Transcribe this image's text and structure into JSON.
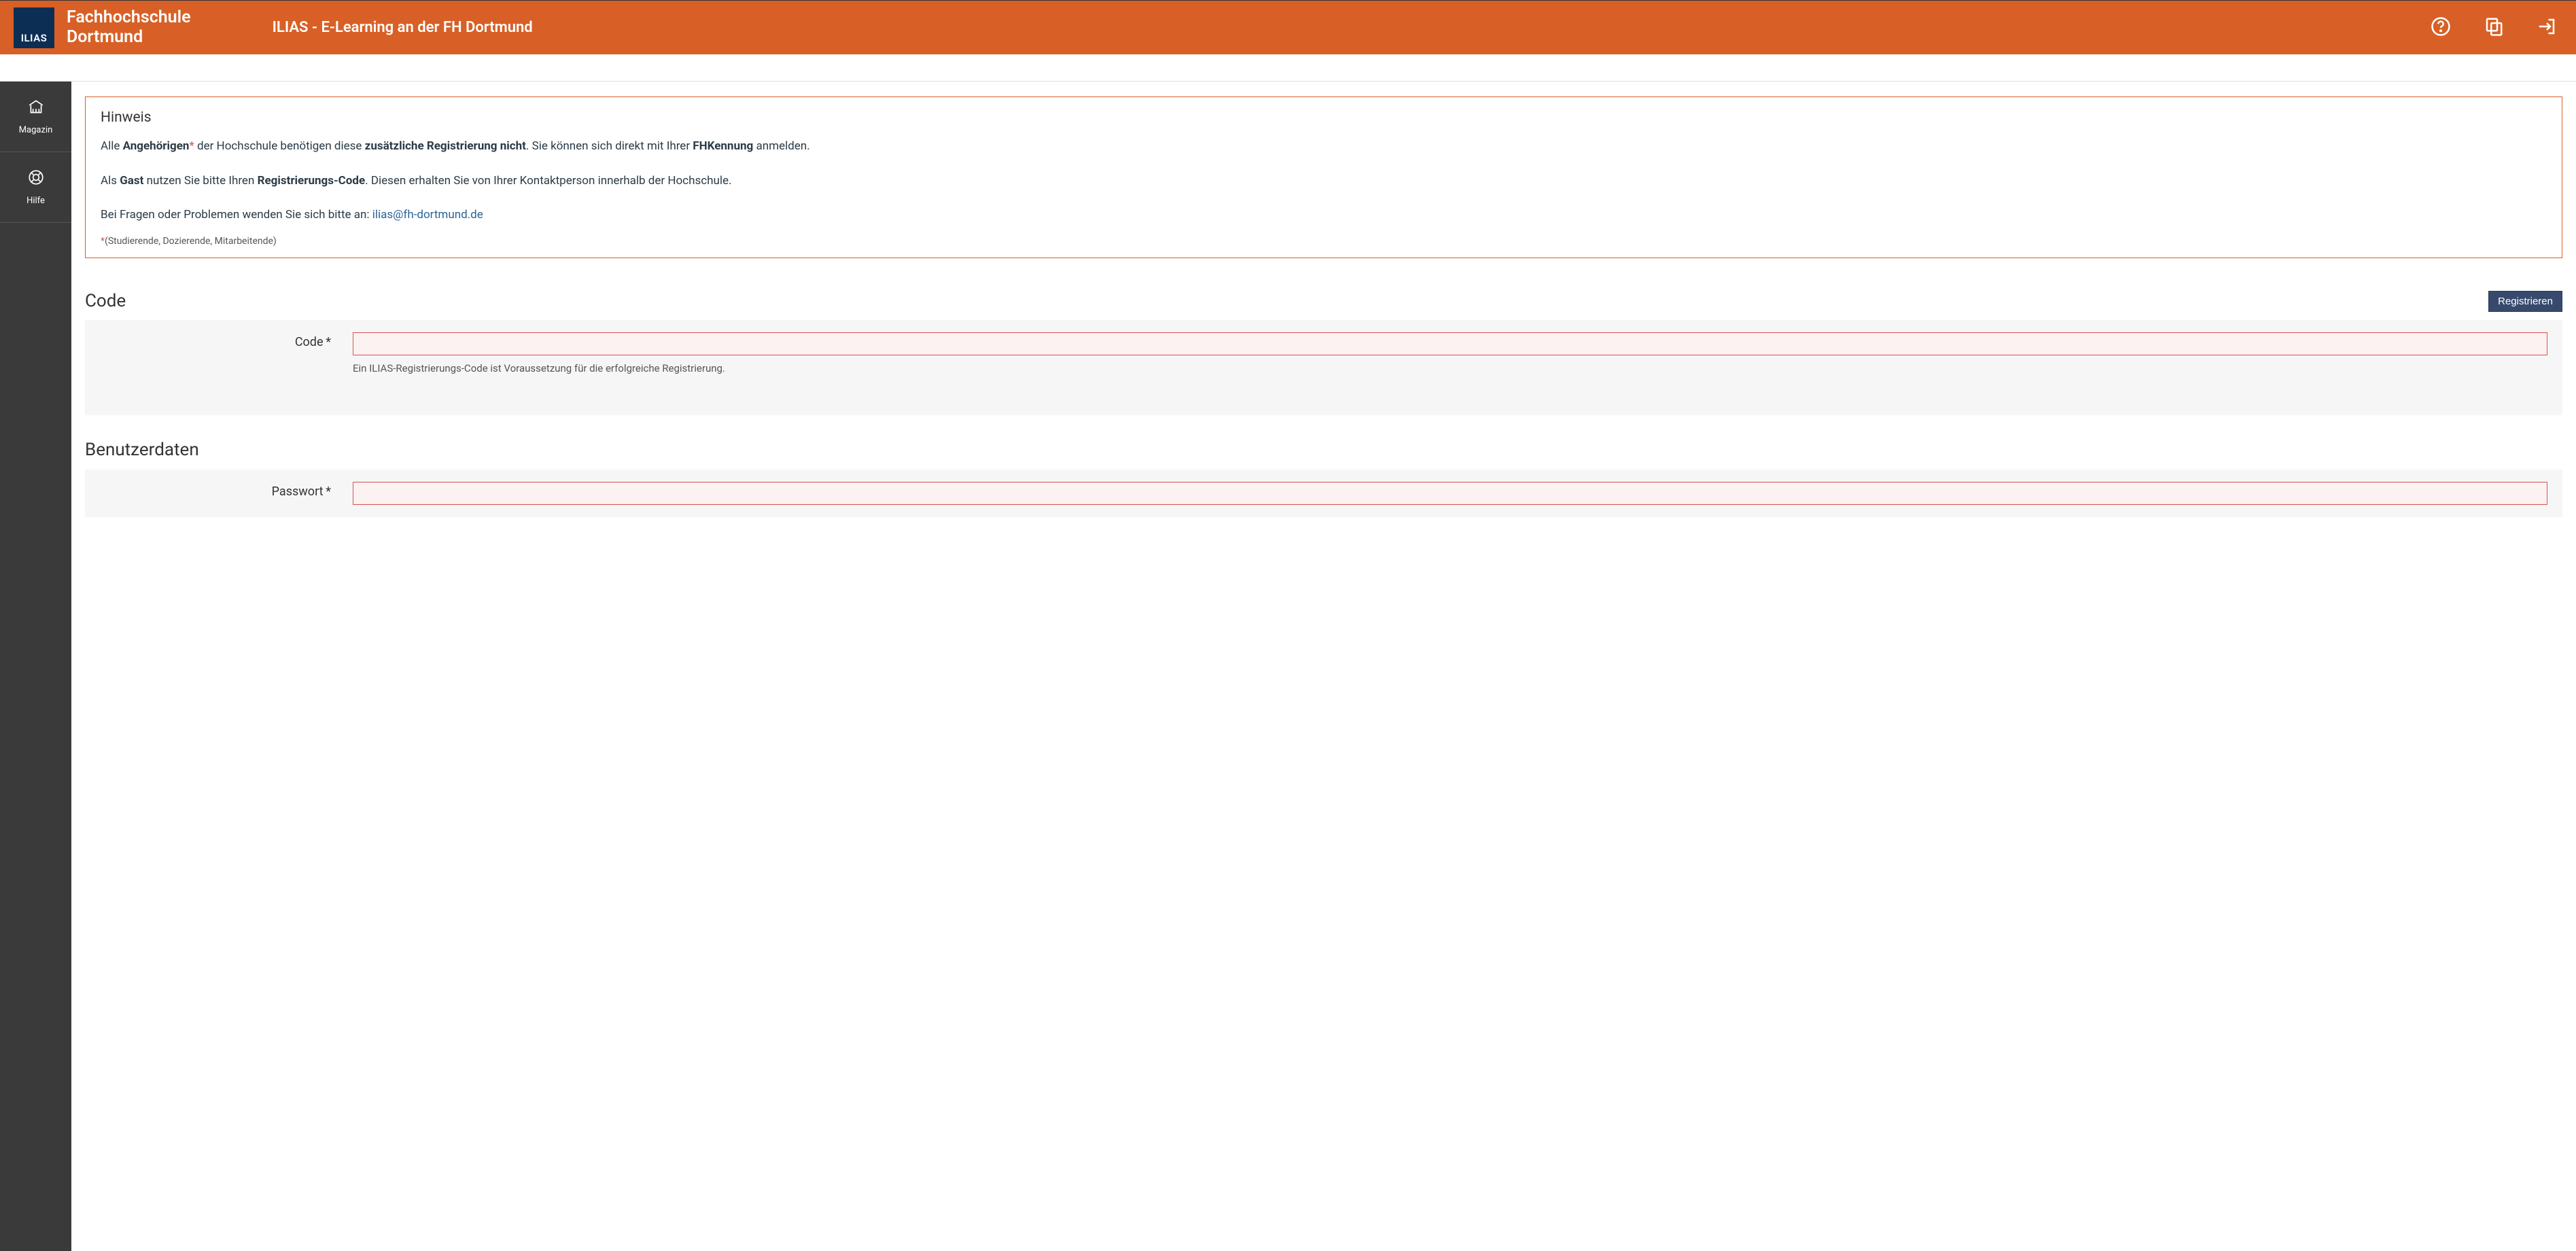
{
  "header": {
    "logo_text": "ILIAS",
    "brand_line1": "Fachhochschule",
    "brand_line2": "Dortmund",
    "page_title": "ILIAS - E-Learning an der FH Dortmund"
  },
  "sidebar": {
    "items": [
      {
        "label": "Magazin"
      },
      {
        "label": "Hilfe"
      }
    ]
  },
  "info": {
    "heading": "Hinweis",
    "p1": {
      "t1": "Alle ",
      "b1": "Angehörigen",
      "ast": "*",
      "t2": " der Hochschule benötigen diese ",
      "b2": "zusätzliche Registrierung nicht",
      "t3": ". Sie können sich direkt mit Ihrer ",
      "b3": "FHKennung",
      "t4": " anmelden."
    },
    "p2": {
      "t1": "Als ",
      "b1": "Gast",
      "t2": " nutzen Sie bitte Ihren ",
      "b2": "Registrierungs-Code",
      "t3": ". Diesen erhalten Sie von Ihrer Kontaktperson innerhalb der Hochschule."
    },
    "p3": {
      "t1": "Bei Fragen oder Problemen wenden Sie sich bitte an: ",
      "email": "ilias@fh-dortmund.de"
    },
    "footnote": {
      "ast": "*",
      "text": "(Studierende, Dozierende, Mitarbeitende)"
    }
  },
  "form": {
    "section_code": "Code",
    "register_btn": "Registrieren",
    "code_label": "Code",
    "code_required": "*",
    "code_help": "Ein ILIAS-Registrierungs-Code ist Voraussetzung für die erfolgreiche Registrierung.",
    "section_user": "Benutzerdaten",
    "password_label": "Passwort",
    "password_required": "*"
  }
}
